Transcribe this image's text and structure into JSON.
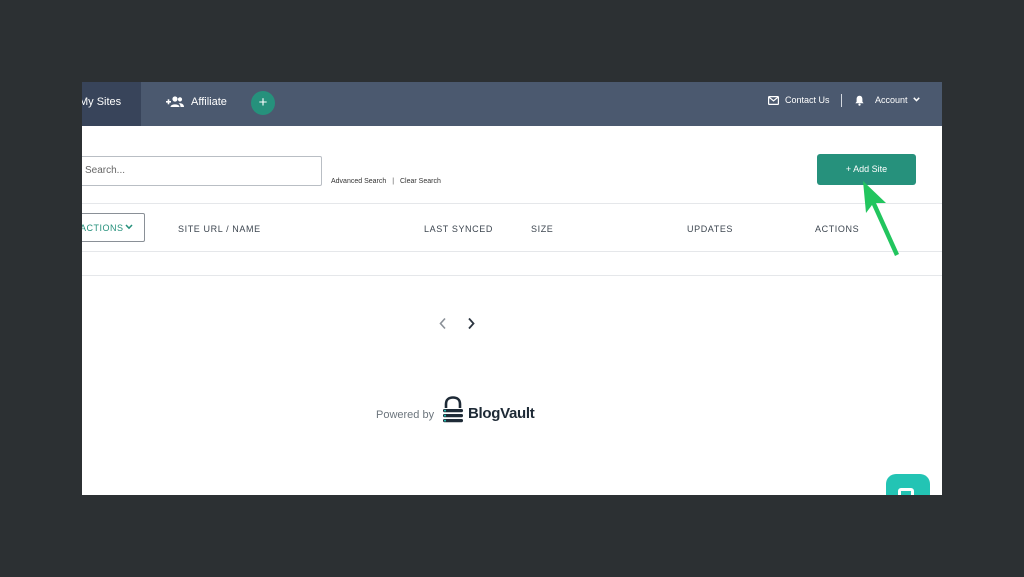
{
  "nav": {
    "my_sites": "My Sites",
    "affiliate": "Affiliate",
    "plus": "+",
    "contact": "Contact Us",
    "account": "Account"
  },
  "search": {
    "placeholder": "Search...",
    "advanced": "Advanced Search",
    "separator": "|",
    "clear": "Clear Search"
  },
  "add_site_label": "+ Add Site",
  "table": {
    "actions_dropdown": "ACTIONS",
    "columns": [
      "SITE URL / NAME",
      "LAST SYNCED",
      "SIZE",
      "UPDATES",
      "ACTIONS"
    ]
  },
  "footer": {
    "powered_by": "Powered by",
    "brand": "BlogVault"
  },
  "colors": {
    "nav_bg": "#4b596f",
    "accent": "#26917c",
    "annotation_arrow": "#22c55e",
    "chat_widget": "#23c4b4"
  },
  "icons": [
    "affiliate-users-icon",
    "mail-icon",
    "bell-icon",
    "chevron-down-icon",
    "chevron-left-icon",
    "chevron-right-icon",
    "blogvault-lock-icon",
    "chat-icon"
  ]
}
